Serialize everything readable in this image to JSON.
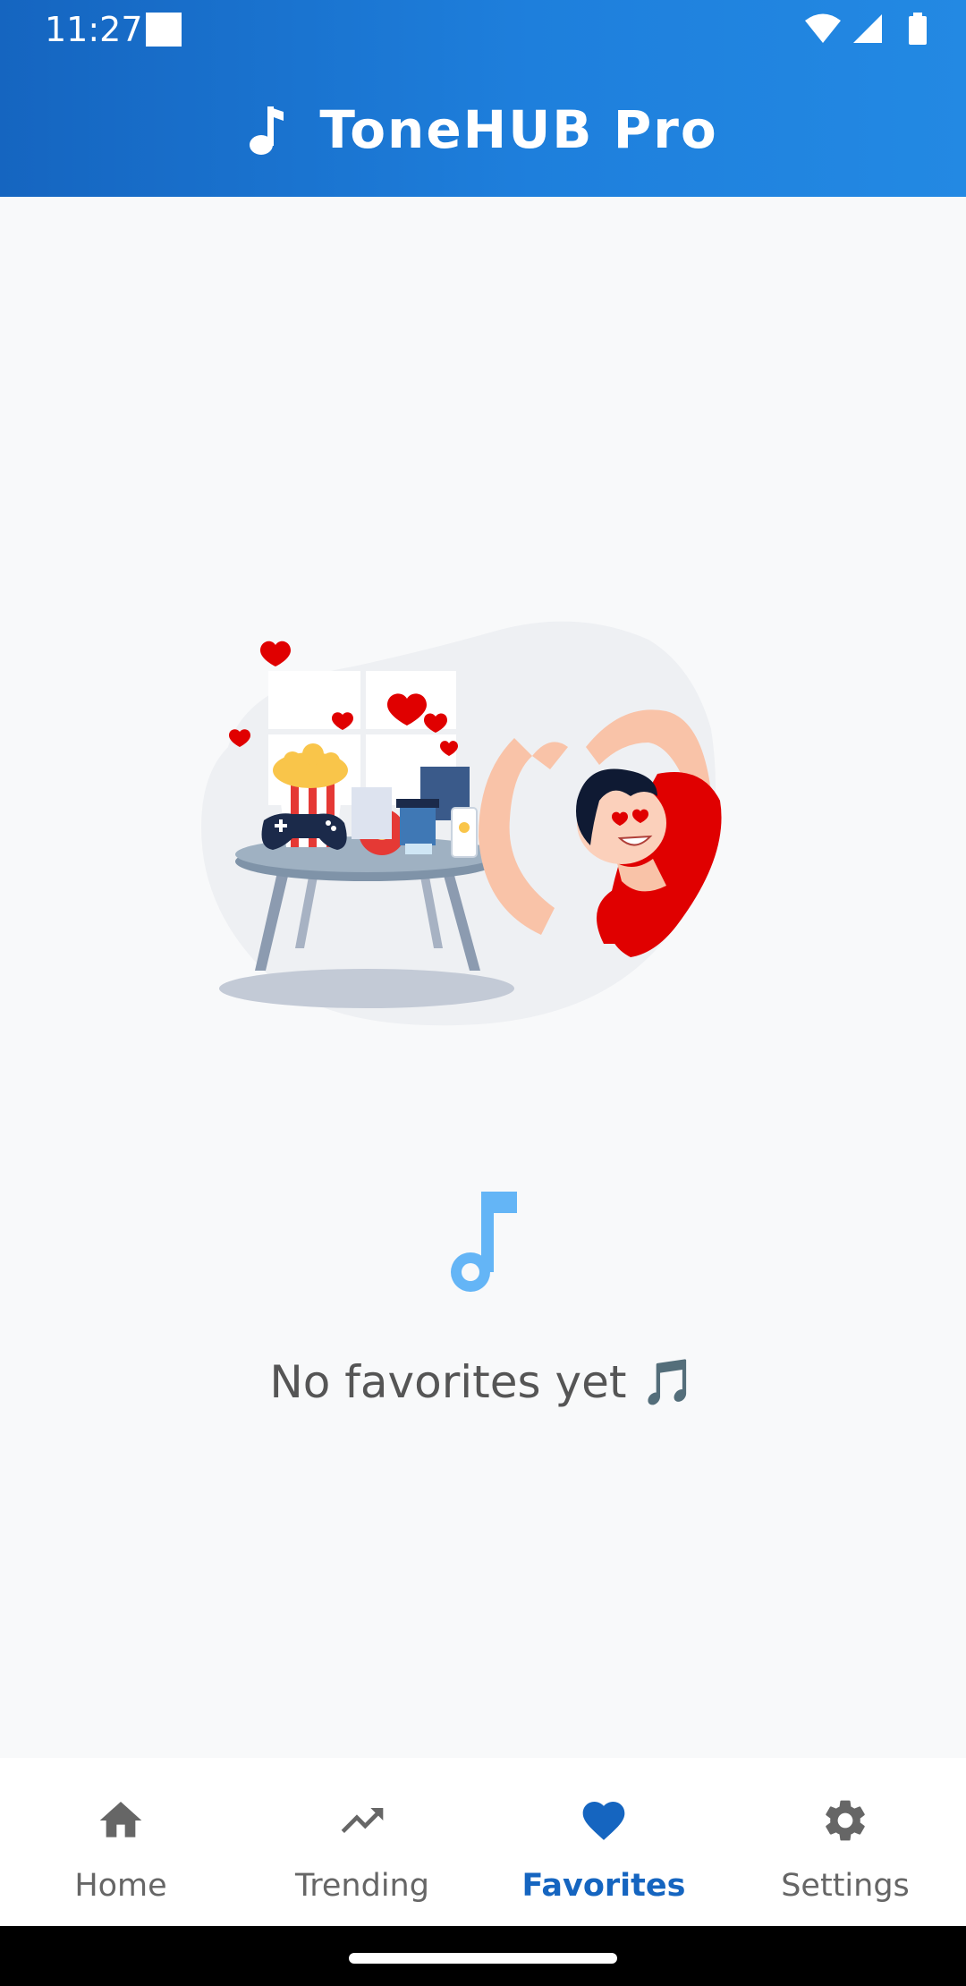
{
  "status_bar": {
    "time": "11:27"
  },
  "app": {
    "title": "ToneHUB Pro",
    "brand_color": "#1565c0",
    "icon": "music-note-icon"
  },
  "empty_state": {
    "message": "No favorites yet 🎵",
    "icon": "music-note-icon",
    "icon_color": "#64b5f6"
  },
  "bottom_nav": {
    "active": "Favorites",
    "items": [
      {
        "label": "Home",
        "icon": "home-icon"
      },
      {
        "label": "Trending",
        "icon": "trending-icon"
      },
      {
        "label": "Favorites",
        "icon": "heart-icon"
      },
      {
        "label": "Settings",
        "icon": "gear-icon"
      }
    ]
  }
}
